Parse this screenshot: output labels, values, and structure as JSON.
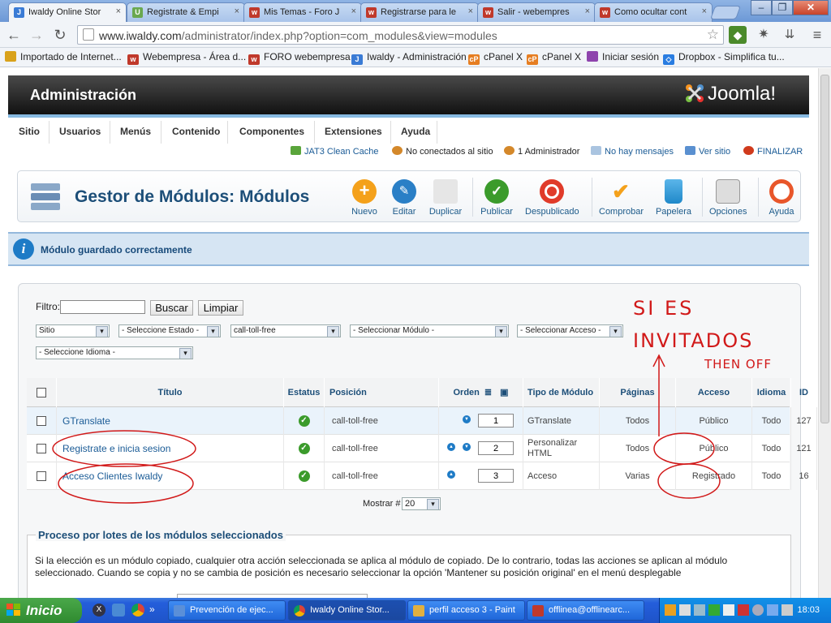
{
  "browser": {
    "tabs": [
      {
        "title": "Iwaldy Online Stor",
        "favicon_color": "#3a7bd5",
        "active": true
      },
      {
        "title": "Registrate & Empi",
        "favicon_color": "#6aa84f",
        "active": false
      },
      {
        "title": "Mis Temas - Foro J",
        "favicon_color": "#c0392b",
        "active": false
      },
      {
        "title": "Registrarse para le",
        "favicon_color": "#c0392b",
        "active": false
      },
      {
        "title": "Salir - webempres",
        "favicon_color": "#c0392b",
        "active": false
      },
      {
        "title": "Como ocultar cont",
        "favicon_color": "#c0392b",
        "active": false
      }
    ],
    "tab_close_glyph": "×",
    "url_host": "www.iwaldy.com",
    "url_path": "/administrator/index.php?option=com_modules&view=modules",
    "bookmarks": [
      {
        "label": "Importado de Internet...",
        "color": "#d9a21b"
      },
      {
        "label": "Webempresa - Área d...",
        "color": "#c0392b"
      },
      {
        "label": "FORO webempresa",
        "color": "#c0392b"
      },
      {
        "label": "Iwaldy - Administración",
        "color": "#3a7bd5"
      },
      {
        "label": "cPanel X",
        "color": "#e67e22"
      },
      {
        "label": "cPanel X",
        "color": "#e67e22"
      },
      {
        "label": "Iniciar sesión",
        "color": "#8e44ad"
      },
      {
        "label": "Dropbox - Simplifica tu...",
        "color": "#2a7de1"
      }
    ]
  },
  "admin": {
    "header_title": "Administración",
    "brand": "Joomla!",
    "menu": [
      "Sitio",
      "Usuarios",
      "Menús",
      "Contenido",
      "Componentes",
      "Extensiones",
      "Ayuda"
    ],
    "status": {
      "cache": "JAT3 Clean Cache",
      "site_users": "No conectados al sitio",
      "admins": "1 Administrador",
      "messages": "No hay mensajes",
      "view_site": "Ver sitio",
      "logout": "FINALIZAR"
    },
    "page_title": "Gestor de Módulos: Módulos",
    "toolbar": {
      "new": "Nuevo",
      "edit": "Editar",
      "duplicate": "Duplicar",
      "publish": "Publicar",
      "unpublish": "Despublicado",
      "checkin": "Comprobar",
      "trash": "Papelera",
      "options": "Opciones",
      "help": "Ayuda"
    },
    "message": "Módulo guardado correctamente",
    "filter": {
      "label": "Filtro:",
      "value": "",
      "search_button": "Buscar",
      "clear_button": "Limpiar",
      "client": "Sitio",
      "state": "- Seleccione Estado -",
      "position": "call-toll-free",
      "module": "- Seleccionar Módulo -",
      "access": "- Seleccionar Acceso -",
      "language": "- Seleccione Idioma -"
    },
    "table": {
      "headers": {
        "title": "Título",
        "status": "Estatus",
        "position": "Posición",
        "order": "Orden",
        "type": "Tipo de Módulo",
        "pages": "Páginas",
        "access": "Acceso",
        "language": "Idioma",
        "id": "ID"
      },
      "rows": [
        {
          "title": "GTranslate",
          "position": "call-toll-free",
          "order": "1",
          "type": "GTranslate",
          "pages": "Todos",
          "access": "Público",
          "language": "Todo",
          "id": "127"
        },
        {
          "title": "Registrate e inicia sesion",
          "position": "call-toll-free",
          "order": "2",
          "type": "Personalizar HTML",
          "pages": "Todos",
          "access": "Público",
          "language": "Todo",
          "id": "121"
        },
        {
          "title": "Acceso Clientes Iwaldy",
          "position": "call-toll-free",
          "order": "3",
          "type": "Acceso",
          "pages": "Varias",
          "access": "Registrado",
          "language": "Todo",
          "id": "16"
        }
      ],
      "status_glyph": "✓"
    },
    "pagination": {
      "label": "Mostrar #",
      "value": "20"
    },
    "batch": {
      "legend": "Proceso por lotes de los módulos seleccionados",
      "text": "Si la elección es un módulo copiado, cualquier otra acción seleccionada se aplica al módulo de copiado. De lo contrario, todas las acciones se aplican al módulo seleccionado. Cuando se copia y no se cambia de posición es necesario seleccionar la opción 'Mantener su posición original' en el menú desplegable"
    }
  },
  "annotation": {
    "color": "#d11919",
    "line1": "SI ES",
    "line2": "INVITADOS",
    "line3": "THEN OFF"
  },
  "taskbar": {
    "start": "Inicio",
    "tasks": [
      {
        "label": "Prevención de ejec...",
        "color": "#5a8fd8"
      },
      {
        "label": "Iwaldy Online Stor...",
        "color": "#3a7bd5"
      },
      {
        "label": "perfil acceso 3 - Paint",
        "color": "#e0b040"
      },
      {
        "label": "offlinea@offlinearc...",
        "color": "#c0392b"
      }
    ],
    "clock": "18:03"
  }
}
